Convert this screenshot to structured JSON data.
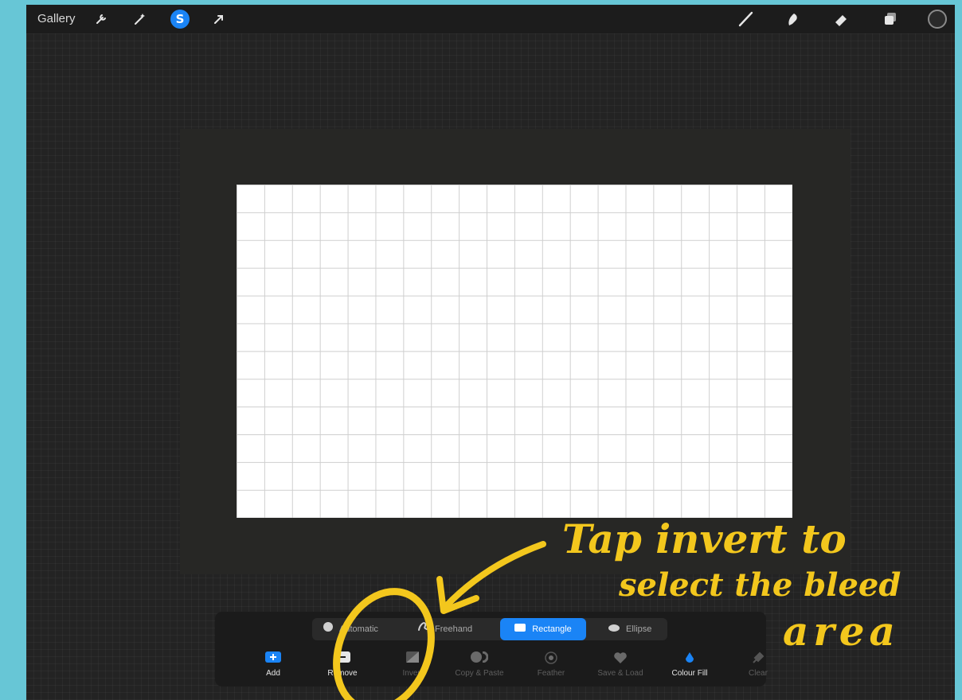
{
  "toolbar": {
    "gallery_label": "Gallery",
    "left_icons": [
      "wrench-icon",
      "adjustments-wand-icon",
      "selection-icon",
      "transform-arrow-icon"
    ],
    "right_icons": [
      "brush-icon",
      "smudge-icon",
      "eraser-icon",
      "layers-icon",
      "color-swatch-icon"
    ]
  },
  "selection_modes": [
    {
      "label": "Automatic",
      "icon": "circle-icon",
      "active": false
    },
    {
      "label": "Freehand",
      "icon": "freehand-icon",
      "active": false
    },
    {
      "label": "Rectangle",
      "icon": "rectangle-icon",
      "active": true
    },
    {
      "label": "Ellipse",
      "icon": "ellipse-icon",
      "active": false
    }
  ],
  "selection_tools": [
    {
      "label": "Add",
      "icon": "add-icon",
      "enabled": true
    },
    {
      "label": "Remove",
      "icon": "remove-icon",
      "enabled": true
    },
    {
      "label": "Invert",
      "icon": "invert-icon",
      "enabled": false
    },
    {
      "label": "Copy & Paste",
      "icon": "copy-paste-icon",
      "enabled": false
    },
    {
      "label": "Feather",
      "icon": "feather-icon",
      "enabled": false
    },
    {
      "label": "Save & Load",
      "icon": "heart-icon",
      "enabled": false
    },
    {
      "label": "Colour Fill",
      "icon": "colour-fill-icon",
      "enabled": true
    },
    {
      "label": "Clear",
      "icon": "clear-icon",
      "enabled": false
    }
  ],
  "annotation": {
    "line1": "Tap invert to",
    "line2": "select the bleed",
    "line3": "area",
    "color": "#f3c71d"
  },
  "colors": {
    "accent": "#1a84f6",
    "background": "#67c6d6"
  }
}
